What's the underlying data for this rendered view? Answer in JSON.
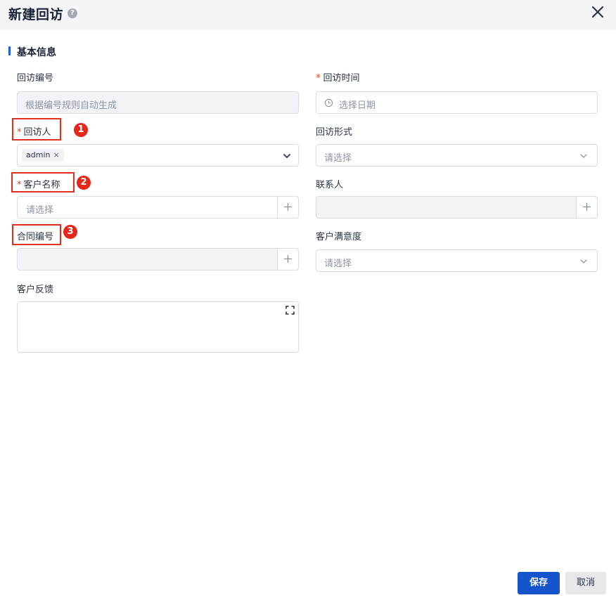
{
  "dialog": {
    "title": "新建回访",
    "help_icon": "question-circle-icon",
    "help_glyph": "?",
    "close_icon": "close-icon"
  },
  "section": {
    "title": "基本信息"
  },
  "fields": {
    "visit_no": {
      "label": "回访编号",
      "placeholder": "根据编号规则自动生成"
    },
    "visit_time": {
      "required_mark": "*",
      "label": "回访时间",
      "placeholder": "选择日期",
      "icon": "clock-icon"
    },
    "visitor": {
      "required_mark": "*",
      "label": "回访人",
      "tag": "admin",
      "tag_remove": "×",
      "icon": "chevron-down-icon"
    },
    "visit_form": {
      "label": "回访形式",
      "placeholder": "请选择",
      "icon": "chevron-down-icon"
    },
    "customer_name": {
      "required_mark": "*",
      "label": "客户名称",
      "placeholder": "请选择",
      "add_icon": "plus-icon"
    },
    "contact": {
      "label": "联系人",
      "placeholder": "",
      "add_icon": "plus-icon"
    },
    "contract_no": {
      "label": "合同编号",
      "placeholder": "",
      "add_icon": "plus-icon"
    },
    "satisfaction": {
      "label": "客户满意度",
      "placeholder": "请选择",
      "icon": "chevron-down-icon"
    },
    "feedback": {
      "label": "客户反馈",
      "value": "",
      "expand_icon": "fullscreen-icon"
    }
  },
  "annotations": {
    "badge_1": "1",
    "badge_2": "2",
    "badge_3": "3",
    "color": "#e0301e"
  },
  "footer": {
    "save_label": "保存",
    "cancel_label": "取消"
  },
  "colors": {
    "primary": "#1554cc",
    "accent_bar": "#1d5ee0",
    "required": "#e3431a",
    "header_bg": "#f4f5f7"
  }
}
